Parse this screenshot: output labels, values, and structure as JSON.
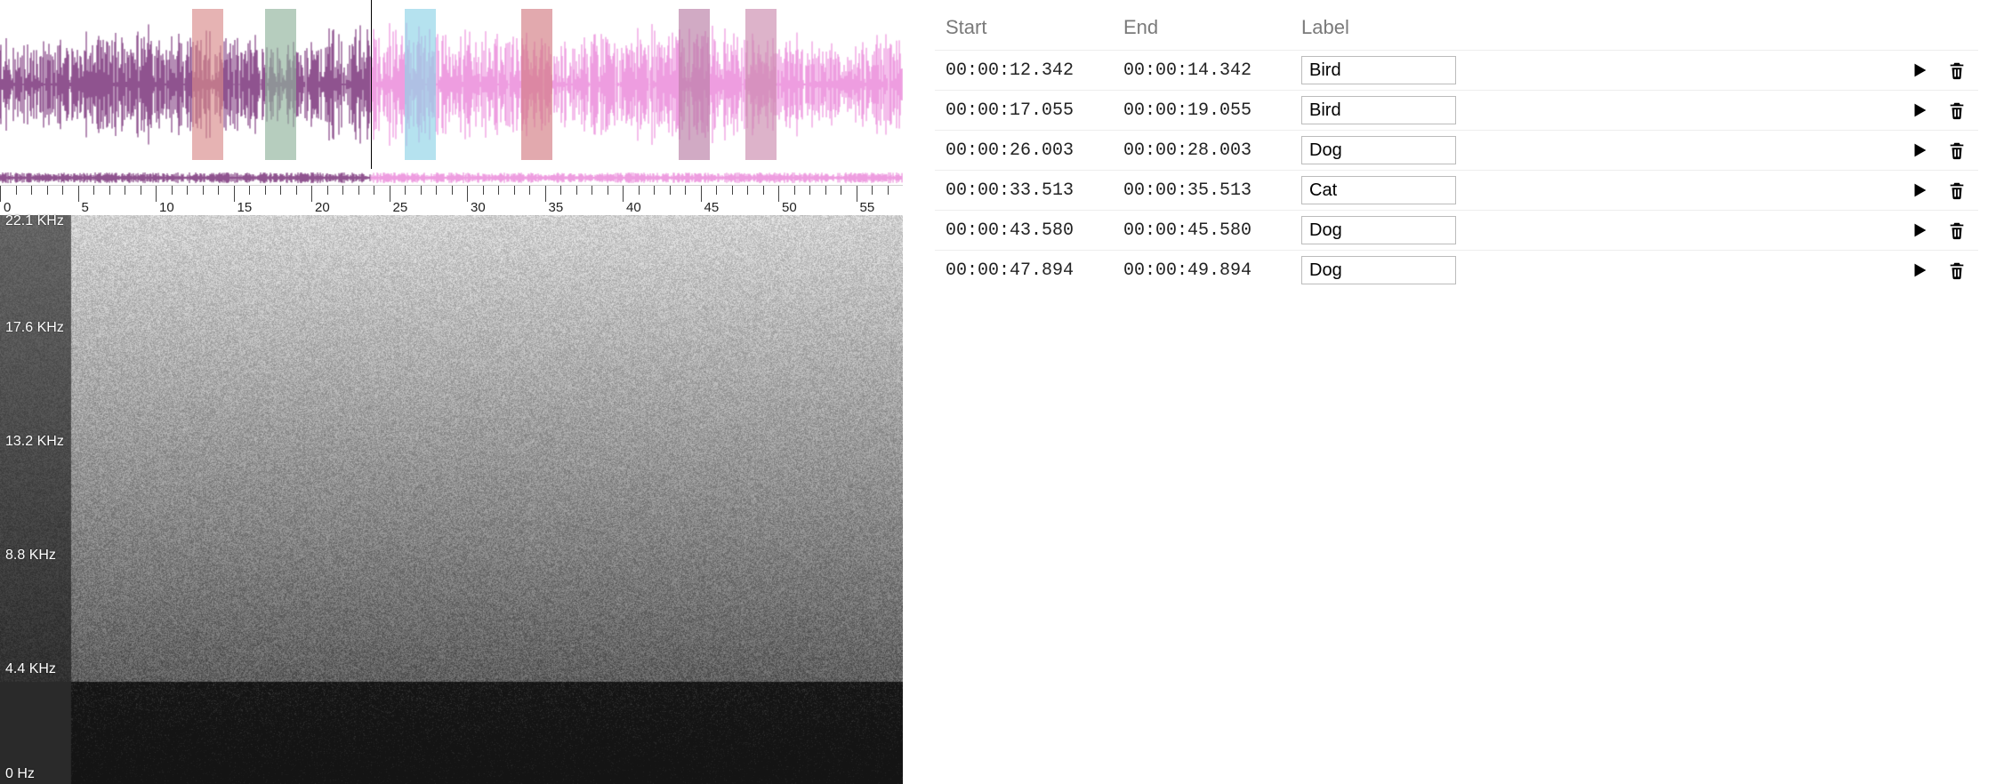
{
  "timeline": {
    "duration_sec": 58,
    "playhead_sec": 23.8,
    "boundary_sec": 23.8,
    "major_tick_interval": 5,
    "minor_ticks_per_major": 5,
    "labels": [
      "0",
      "5",
      "10",
      "15",
      "20",
      "25",
      "30",
      "35",
      "40",
      "45",
      "50",
      "55"
    ],
    "wave_colors": {
      "left": "#6a1b6a",
      "right": "#e87dd6"
    }
  },
  "regions": [
    {
      "start": 12.342,
      "end": 14.342,
      "color": "#d98a8a"
    },
    {
      "start": 17.055,
      "end": 19.055,
      "color": "#8fb29b"
    },
    {
      "start": 26.003,
      "end": 28.003,
      "color": "#8ed2e6"
    },
    {
      "start": 33.513,
      "end": 35.513,
      "color": "#d37b82"
    },
    {
      "start": 43.58,
      "end": 45.58,
      "color": "#b87da4"
    },
    {
      "start": 47.894,
      "end": 49.894,
      "color": "#cb8bad"
    }
  ],
  "spectrogram": {
    "freq_labels": [
      {
        "text": "22.1 KHz",
        "pos": 0.0
      },
      {
        "text": "17.6 KHz",
        "pos": 0.2
      },
      {
        "text": "13.2 KHz",
        "pos": 0.4
      },
      {
        "text": "8.8  KHz",
        "pos": 0.6
      },
      {
        "text": "4.4  KHz",
        "pos": 0.8
      },
      {
        "text": "0   Hz",
        "pos": 0.985
      }
    ]
  },
  "table": {
    "headers": {
      "start": "Start",
      "end": "End",
      "label": "Label"
    },
    "rows": [
      {
        "start": "00:00:12.342",
        "end": "00:00:14.342",
        "label": "Bird"
      },
      {
        "start": "00:00:17.055",
        "end": "00:00:19.055",
        "label": "Bird"
      },
      {
        "start": "00:00:26.003",
        "end": "00:00:28.003",
        "label": "Dog"
      },
      {
        "start": "00:00:33.513",
        "end": "00:00:35.513",
        "label": "Cat"
      },
      {
        "start": "00:00:43.580",
        "end": "00:00:45.580",
        "label": "Dog"
      },
      {
        "start": "00:00:47.894",
        "end": "00:00:49.894",
        "label": "Dog"
      }
    ]
  },
  "icons": {
    "play": "play-icon",
    "delete": "trash-icon"
  }
}
